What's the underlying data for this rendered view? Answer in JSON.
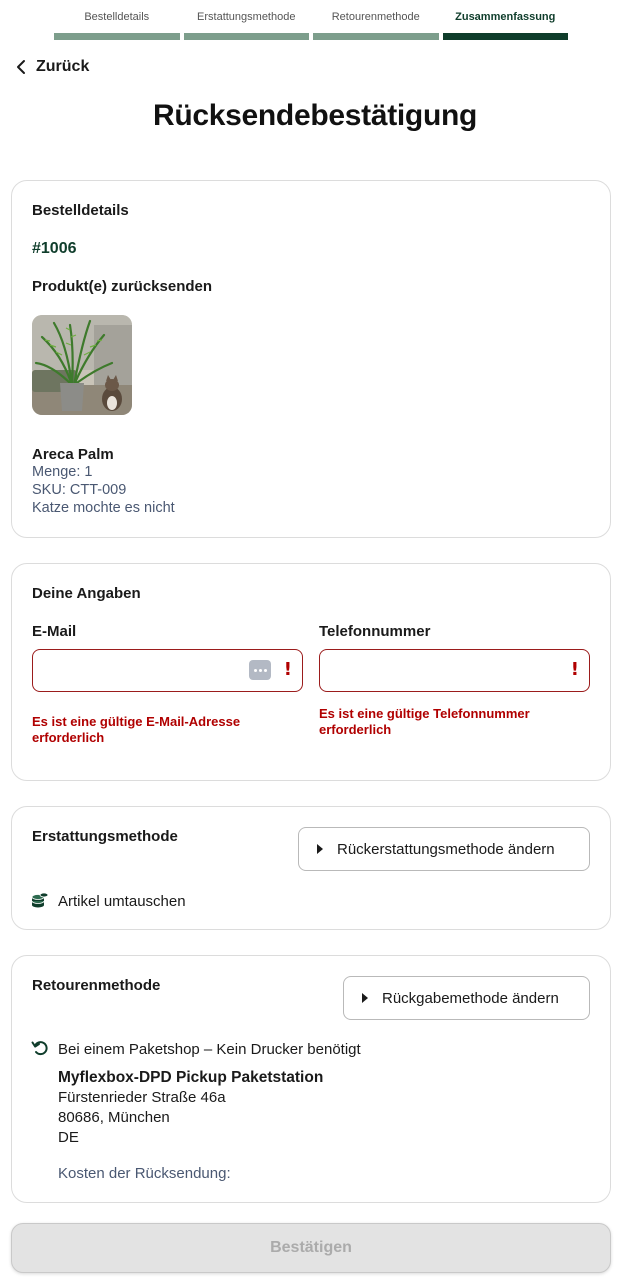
{
  "stepper": {
    "steps": [
      {
        "label": "Bestelldetails",
        "active": false
      },
      {
        "label": "Erstattungsmethode",
        "active": false
      },
      {
        "label": "Retourenmethode",
        "active": false
      },
      {
        "label": "Zusammenfassung",
        "active": true
      }
    ]
  },
  "nav": {
    "back_label": "Zurück"
  },
  "page": {
    "title": "Rücksendebestätigung"
  },
  "order": {
    "section_title": "Bestelldetails",
    "number": "#1006",
    "products_title": "Produkt(e) zurücksenden",
    "product": {
      "name": "Areca Palm",
      "quantity": "Menge: 1",
      "sku": "SKU: CTT-009",
      "reason": "Katze mochte es nicht"
    }
  },
  "info": {
    "section_title": "Deine Angaben",
    "email": {
      "label": "E-Mail",
      "value": "",
      "placeholder": "",
      "error": "Es ist eine gültige E-Mail-Adresse erforderlich"
    },
    "phone": {
      "label": "Telefonnummer",
      "value": "",
      "placeholder": "",
      "error": "Es ist eine gültige Telefonnummer erforderlich"
    },
    "error_glyph": "!"
  },
  "refund": {
    "section_title": "Erstattungsmethode",
    "change_label": "Rückerstattungsmethode ändern",
    "method": "Artikel umtauschen",
    "icon": "coins-icon"
  },
  "return_method": {
    "section_title": "Retourenmethode",
    "change_label": "Rückgabemethode ändern",
    "method": "Bei einem Paketshop – Kein Drucker benötigt",
    "icon": "return-arrow-icon",
    "location": {
      "name": "Myflexbox-DPD Pickup Paketstation",
      "street": "Fürstenrieder Straße 46a",
      "city": "80686, München",
      "country": "DE"
    },
    "cost_label": "Kosten der Rücksendung:"
  },
  "actions": {
    "confirm_label": "Bestätigen",
    "confirm_disabled": true
  },
  "colors": {
    "brand": "#0f3d2b",
    "step_inactive": "#7d9e8c",
    "error": "#b00000",
    "muted_text": "#4a5872"
  }
}
